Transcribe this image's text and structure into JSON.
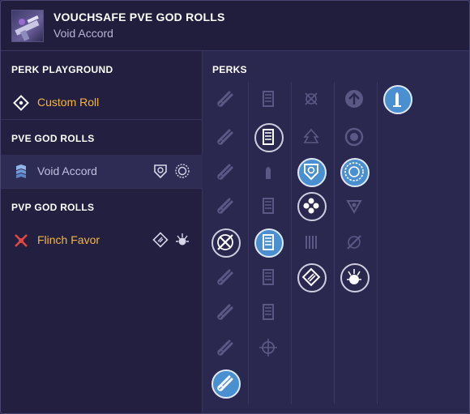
{
  "header": {
    "title": "VOUCHSAFE PVE GOD ROLLS",
    "subtitle": "Void Accord",
    "weapon_icon": "weapon-icon"
  },
  "sidebar": {
    "perk_playground": {
      "title": "PERK PLAYGROUND",
      "items": [
        {
          "label": "Custom Roll",
          "icon": "target-reticle-icon"
        }
      ]
    },
    "pve_god_rolls": {
      "title": "PVE GOD ROLLS",
      "items": [
        {
          "label": "Void Accord",
          "icon": "void-chevron-icon",
          "perk_icons": [
            "shield-perk-icon",
            "void-ring-perk-icon"
          ]
        }
      ]
    },
    "pvp_god_rolls": {
      "title": "PVP GOD ROLLS",
      "items": [
        {
          "label": "Flinch Favor",
          "icon": "crossed-x-icon",
          "perk_icons": [
            "diamond-spiral-perk-icon",
            "spiked-orb-perk-icon"
          ]
        }
      ]
    }
  },
  "perks": {
    "title": "PERKS",
    "columns": [
      {
        "name": "barrels",
        "perks": [
          {
            "icon": "barrel-icon",
            "state": "inactive"
          },
          {
            "icon": "barrel-icon",
            "state": "inactive"
          },
          {
            "icon": "barrel-icon",
            "state": "inactive"
          },
          {
            "icon": "barrel-icon",
            "state": "inactive"
          },
          {
            "icon": "barrel-crossed-icon",
            "state": "outlined"
          },
          {
            "icon": "barrel-icon",
            "state": "inactive"
          },
          {
            "icon": "barrel-icon",
            "state": "inactive"
          },
          {
            "icon": "barrel-icon",
            "state": "inactive"
          },
          {
            "icon": "barrel-icon",
            "state": "selected"
          }
        ]
      },
      {
        "name": "magazines",
        "perks": [
          {
            "icon": "magazine-icon",
            "state": "inactive"
          },
          {
            "icon": "magazine-icon",
            "state": "outlined"
          },
          {
            "icon": "round-icon",
            "state": "inactive"
          },
          {
            "icon": "magazine-icon",
            "state": "inactive"
          },
          {
            "icon": "magazine-icon",
            "state": "selected"
          },
          {
            "icon": "magazine-icon",
            "state": "inactive"
          },
          {
            "icon": "magazine-icon",
            "state": "inactive"
          },
          {
            "icon": "crosshair-icon",
            "state": "inactive"
          }
        ]
      },
      {
        "name": "trait1",
        "perks": [
          {
            "icon": "crossed-circle-icon",
            "state": "inactive"
          },
          {
            "icon": "tree-icon",
            "state": "inactive"
          },
          {
            "icon": "shield-perk-icon",
            "state": "selected"
          },
          {
            "icon": "dpad-icon",
            "state": "outlined"
          },
          {
            "icon": "bars-icon",
            "state": "inactive"
          },
          {
            "icon": "diamond-spiral-perk-icon",
            "state": "outlined"
          }
        ]
      },
      {
        "name": "trait2",
        "perks": [
          {
            "icon": "up-arrow-icon",
            "state": "inactive"
          },
          {
            "icon": "ring-icon",
            "state": "inactive"
          },
          {
            "icon": "void-ring-perk-icon",
            "state": "selected"
          },
          {
            "icon": "triangle-icon",
            "state": "inactive"
          },
          {
            "icon": "slashed-circle-icon",
            "state": "inactive"
          },
          {
            "icon": "spiked-orb-perk-icon",
            "state": "outlined"
          }
        ]
      },
      {
        "name": "origin",
        "perks": [
          {
            "icon": "tower-icon",
            "state": "selected"
          }
        ]
      }
    ]
  }
}
